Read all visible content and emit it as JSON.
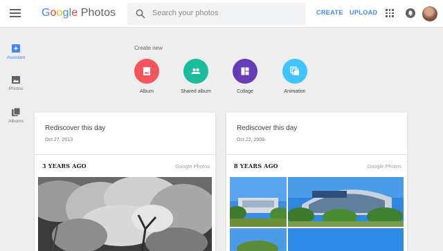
{
  "header": {
    "logo_g": "G",
    "logo_o1": "o",
    "logo_o2": "o",
    "logo_g2": "g",
    "logo_l": "l",
    "logo_e": "e",
    "logo_product": "Photos",
    "search_placeholder": "Search your photos",
    "create_label": "CREATE",
    "upload_label": "UPLOAD"
  },
  "sidebar": {
    "items": [
      {
        "label": "Assistant",
        "icon": "assistant-icon",
        "active": true
      },
      {
        "label": "Photos",
        "icon": "photo-icon",
        "active": false
      },
      {
        "label": "Albums",
        "icon": "albums-icon",
        "active": false
      }
    ]
  },
  "create_new": {
    "title": "Create new",
    "items": [
      {
        "label": "Album",
        "icon": "album-icon",
        "color": "#f4545b"
      },
      {
        "label": "Shared album",
        "icon": "people-icon",
        "color": "#1abc9c"
      },
      {
        "label": "Collage",
        "icon": "collage-icon",
        "color": "#673ab7"
      },
      {
        "label": "Animation",
        "icon": "animation-icon",
        "color": "#40c4ff"
      }
    ]
  },
  "cards": [
    {
      "title": "Rediscover this day",
      "date": "Oct 27, 2013",
      "years_ago": "3 YEARS AGO",
      "brand": "Google Photos"
    },
    {
      "title": "Rediscover this day",
      "date": "Oct 22, 2008",
      "years_ago": "8 YEARS AGO",
      "brand": "Google Photos"
    }
  ],
  "colors": {
    "accent": "#4285f4",
    "background": "#eeeeee"
  }
}
